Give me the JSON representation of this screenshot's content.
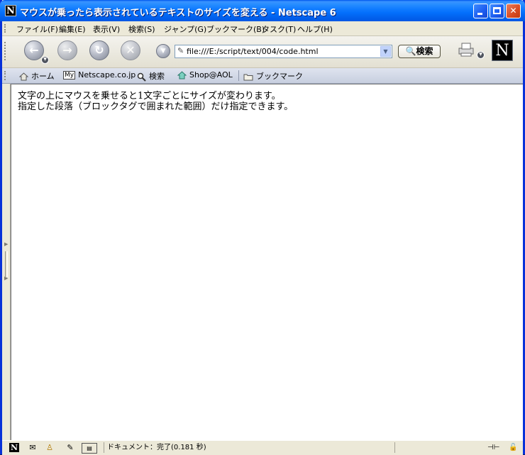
{
  "window": {
    "title": "マウスが乗ったら表示されているテキストのサイズを変える - Netscape 6",
    "app_icon_letter": "N",
    "min_symbol": "",
    "max_symbol": "",
    "close_symbol": "✕"
  },
  "menu": {
    "items": [
      {
        "label": "ファイル(F)"
      },
      {
        "label": "編集(E)"
      },
      {
        "label": "表示(V)"
      },
      {
        "label": "検索(S)"
      },
      {
        "label": "ジャンプ(G)"
      },
      {
        "label": "ブックマーク(B)"
      },
      {
        "label": "タスク(T)"
      },
      {
        "label": "ヘルプ(H)"
      }
    ]
  },
  "nav": {
    "back_glyph": "←",
    "forward_glyph": "→",
    "reload_glyph": "↻",
    "stop_glyph": "✕",
    "url_value": "file:///E:/script/text/004/code.html",
    "search_label": "🔍検索",
    "logo_letter": "N"
  },
  "personal_toolbar": {
    "items": [
      {
        "label": "ホーム",
        "icon": "home-icon"
      },
      {
        "label": "Netscape.co.jp",
        "icon": "my-netscape-icon",
        "badge": "My"
      },
      {
        "label": "検索",
        "icon": "search-icon"
      },
      {
        "label": "Shop@AOL",
        "icon": "shop-icon"
      },
      {
        "label": "ブックマーク",
        "icon": "folder-icon"
      }
    ]
  },
  "content": {
    "lines": [
      "文字の上にマウスを乗せると1文字ごとにサイズが変わります。",
      "指定した段落（ブロックタグで囲まれた範囲）だけ指定できます。"
    ]
  },
  "status": {
    "text": "ドキュメント：完了(0.181 秒)"
  },
  "colors": {
    "titlebar": "#0058ee",
    "window_frame": "#0831d9",
    "chrome": "#ece9d8",
    "personal_bar": "#c7cfdf"
  }
}
